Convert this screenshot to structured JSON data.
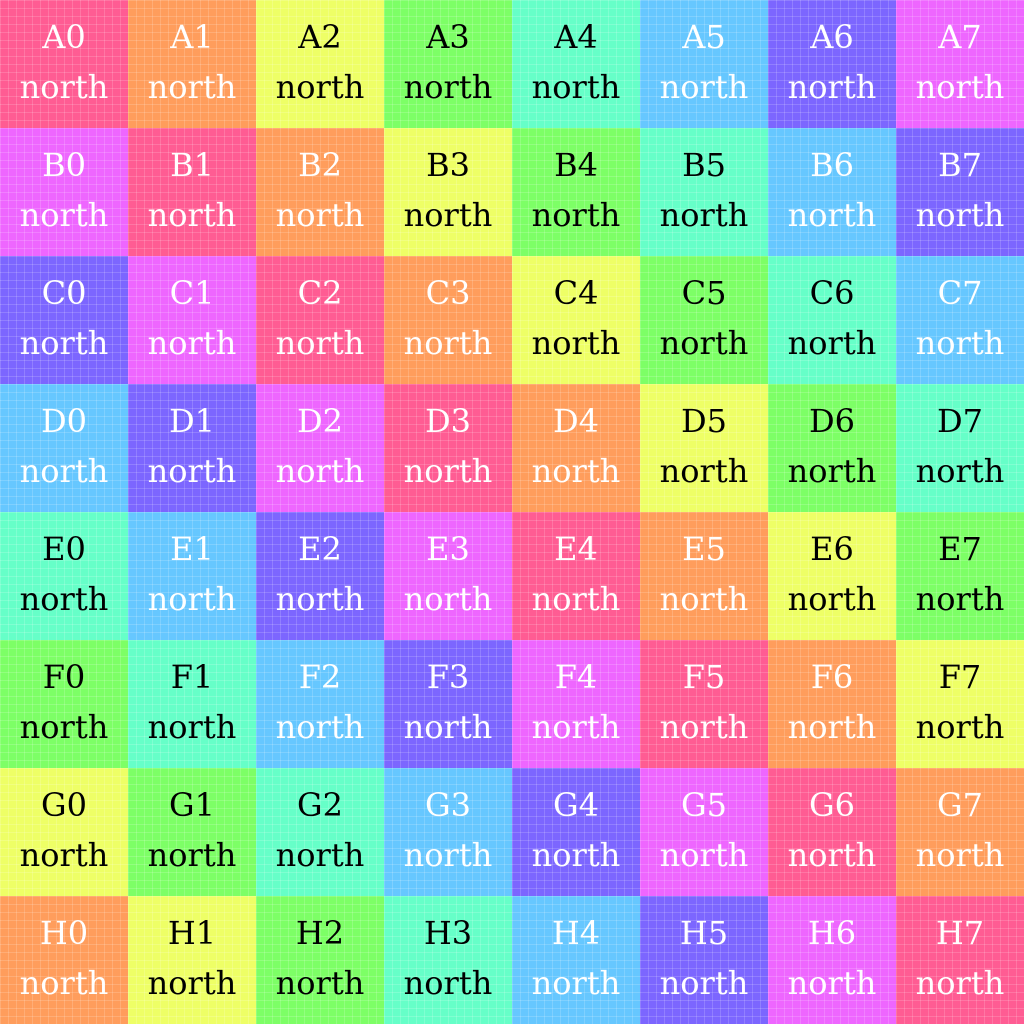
{
  "palette": {
    "pink": "#ff5c93",
    "orange": "#ff9d5c",
    "yellow": "#eeff66",
    "green": "#7dff66",
    "mint": "#66ffc8",
    "sky": "#66c7ff",
    "violet": "#7c66ff",
    "magenta": "#ee66ff"
  },
  "rows": [
    {
      "cells": [
        {
          "label": "A0",
          "direction": "north",
          "color": "#ff5c93",
          "text_color": "#ffffff"
        },
        {
          "label": "A1",
          "direction": "north",
          "color": "#ff9d5c",
          "text_color": "#ffffff"
        },
        {
          "label": "A2",
          "direction": "north",
          "color": "#eeff66",
          "text_color": "#000000"
        },
        {
          "label": "A3",
          "direction": "north",
          "color": "#7dff66",
          "text_color": "#000000"
        },
        {
          "label": "A4",
          "direction": "north",
          "color": "#66ffc8",
          "text_color": "#000000"
        },
        {
          "label": "A5",
          "direction": "north",
          "color": "#66c7ff",
          "text_color": "#ffffff"
        },
        {
          "label": "A6",
          "direction": "north",
          "color": "#7c66ff",
          "text_color": "#ffffff"
        },
        {
          "label": "A7",
          "direction": "north",
          "color": "#ee66ff",
          "text_color": "#ffffff"
        }
      ]
    },
    {
      "cells": [
        {
          "label": "B0",
          "direction": "north",
          "color": "#ee66ff",
          "text_color": "#ffffff"
        },
        {
          "label": "B1",
          "direction": "north",
          "color": "#ff5c93",
          "text_color": "#ffffff"
        },
        {
          "label": "B2",
          "direction": "north",
          "color": "#ff9d5c",
          "text_color": "#ffffff"
        },
        {
          "label": "B3",
          "direction": "north",
          "color": "#eeff66",
          "text_color": "#000000"
        },
        {
          "label": "B4",
          "direction": "north",
          "color": "#7dff66",
          "text_color": "#000000"
        },
        {
          "label": "B5",
          "direction": "north",
          "color": "#66ffc8",
          "text_color": "#000000"
        },
        {
          "label": "B6",
          "direction": "north",
          "color": "#66c7ff",
          "text_color": "#ffffff"
        },
        {
          "label": "B7",
          "direction": "north",
          "color": "#7c66ff",
          "text_color": "#ffffff"
        }
      ]
    },
    {
      "cells": [
        {
          "label": "C0",
          "direction": "north",
          "color": "#7c66ff",
          "text_color": "#ffffff"
        },
        {
          "label": "C1",
          "direction": "north",
          "color": "#ee66ff",
          "text_color": "#ffffff"
        },
        {
          "label": "C2",
          "direction": "north",
          "color": "#ff5c93",
          "text_color": "#ffffff"
        },
        {
          "label": "C3",
          "direction": "north",
          "color": "#ff9d5c",
          "text_color": "#ffffff"
        },
        {
          "label": "C4",
          "direction": "north",
          "color": "#eeff66",
          "text_color": "#000000"
        },
        {
          "label": "C5",
          "direction": "north",
          "color": "#7dff66",
          "text_color": "#000000"
        },
        {
          "label": "C6",
          "direction": "north",
          "color": "#66ffc8",
          "text_color": "#000000"
        },
        {
          "label": "C7",
          "direction": "north",
          "color": "#66c7ff",
          "text_color": "#ffffff"
        }
      ]
    },
    {
      "cells": [
        {
          "label": "D0",
          "direction": "north",
          "color": "#66c7ff",
          "text_color": "#ffffff"
        },
        {
          "label": "D1",
          "direction": "north",
          "color": "#7c66ff",
          "text_color": "#ffffff"
        },
        {
          "label": "D2",
          "direction": "north",
          "color": "#ee66ff",
          "text_color": "#ffffff"
        },
        {
          "label": "D3",
          "direction": "north",
          "color": "#ff5c93",
          "text_color": "#ffffff"
        },
        {
          "label": "D4",
          "direction": "north",
          "color": "#ff9d5c",
          "text_color": "#ffffff"
        },
        {
          "label": "D5",
          "direction": "north",
          "color": "#eeff66",
          "text_color": "#000000"
        },
        {
          "label": "D6",
          "direction": "north",
          "color": "#7dff66",
          "text_color": "#000000"
        },
        {
          "label": "D7",
          "direction": "north",
          "color": "#66ffc8",
          "text_color": "#000000"
        }
      ]
    },
    {
      "cells": [
        {
          "label": "E0",
          "direction": "north",
          "color": "#66ffc8",
          "text_color": "#000000"
        },
        {
          "label": "E1",
          "direction": "north",
          "color": "#66c7ff",
          "text_color": "#ffffff"
        },
        {
          "label": "E2",
          "direction": "north",
          "color": "#7c66ff",
          "text_color": "#ffffff"
        },
        {
          "label": "E3",
          "direction": "north",
          "color": "#ee66ff",
          "text_color": "#ffffff"
        },
        {
          "label": "E4",
          "direction": "north",
          "color": "#ff5c93",
          "text_color": "#ffffff"
        },
        {
          "label": "E5",
          "direction": "north",
          "color": "#ff9d5c",
          "text_color": "#ffffff"
        },
        {
          "label": "E6",
          "direction": "north",
          "color": "#eeff66",
          "text_color": "#000000"
        },
        {
          "label": "E7",
          "direction": "north",
          "color": "#7dff66",
          "text_color": "#000000"
        }
      ]
    },
    {
      "cells": [
        {
          "label": "F0",
          "direction": "north",
          "color": "#7dff66",
          "text_color": "#000000"
        },
        {
          "label": "F1",
          "direction": "north",
          "color": "#66ffc8",
          "text_color": "#000000"
        },
        {
          "label": "F2",
          "direction": "north",
          "color": "#66c7ff",
          "text_color": "#ffffff"
        },
        {
          "label": "F3",
          "direction": "north",
          "color": "#7c66ff",
          "text_color": "#ffffff"
        },
        {
          "label": "F4",
          "direction": "north",
          "color": "#ee66ff",
          "text_color": "#ffffff"
        },
        {
          "label": "F5",
          "direction": "north",
          "color": "#ff5c93",
          "text_color": "#ffffff"
        },
        {
          "label": "F6",
          "direction": "north",
          "color": "#ff9d5c",
          "text_color": "#ffffff"
        },
        {
          "label": "F7",
          "direction": "north",
          "color": "#eeff66",
          "text_color": "#000000"
        }
      ]
    },
    {
      "cells": [
        {
          "label": "G0",
          "direction": "north",
          "color": "#eeff66",
          "text_color": "#000000"
        },
        {
          "label": "G1",
          "direction": "north",
          "color": "#7dff66",
          "text_color": "#000000"
        },
        {
          "label": "G2",
          "direction": "north",
          "color": "#66ffc8",
          "text_color": "#000000"
        },
        {
          "label": "G3",
          "direction": "north",
          "color": "#66c7ff",
          "text_color": "#ffffff"
        },
        {
          "label": "G4",
          "direction": "north",
          "color": "#7c66ff",
          "text_color": "#ffffff"
        },
        {
          "label": "G5",
          "direction": "north",
          "color": "#ee66ff",
          "text_color": "#ffffff"
        },
        {
          "label": "G6",
          "direction": "north",
          "color": "#ff5c93",
          "text_color": "#ffffff"
        },
        {
          "label": "G7",
          "direction": "north",
          "color": "#ff9d5c",
          "text_color": "#ffffff"
        }
      ]
    },
    {
      "cells": [
        {
          "label": "H0",
          "direction": "north",
          "color": "#ff9d5c",
          "text_color": "#ffffff"
        },
        {
          "label": "H1",
          "direction": "north",
          "color": "#eeff66",
          "text_color": "#000000"
        },
        {
          "label": "H2",
          "direction": "north",
          "color": "#7dff66",
          "text_color": "#000000"
        },
        {
          "label": "H3",
          "direction": "north",
          "color": "#66ffc8",
          "text_color": "#000000"
        },
        {
          "label": "H4",
          "direction": "north",
          "color": "#66c7ff",
          "text_color": "#ffffff"
        },
        {
          "label": "H5",
          "direction": "north",
          "color": "#7c66ff",
          "text_color": "#ffffff"
        },
        {
          "label": "H6",
          "direction": "north",
          "color": "#ee66ff",
          "text_color": "#ffffff"
        },
        {
          "label": "H7",
          "direction": "north",
          "color": "#ff5c93",
          "text_color": "#ffffff"
        }
      ]
    }
  ]
}
